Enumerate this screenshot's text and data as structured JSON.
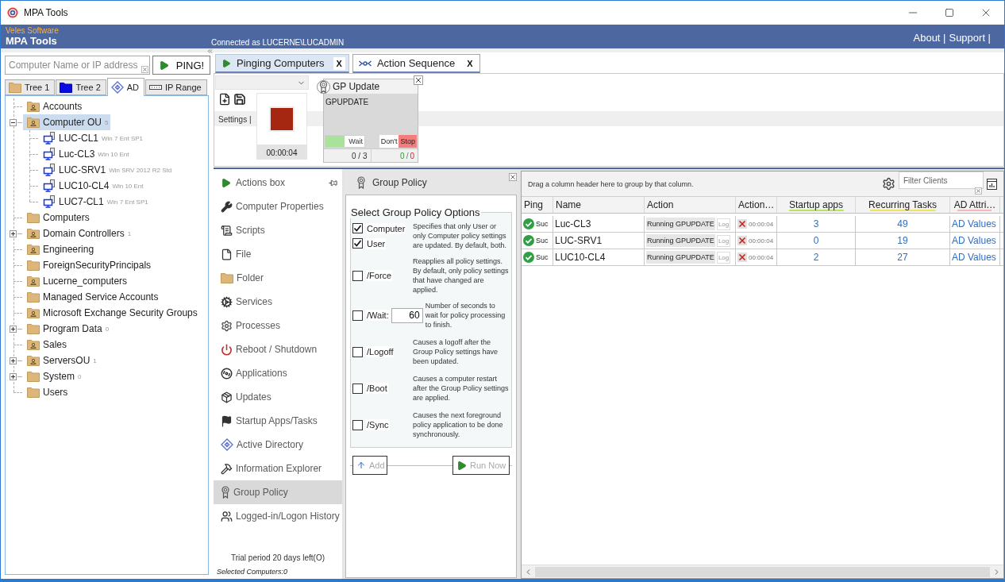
{
  "window": {
    "title": "MPA Tools"
  },
  "header": {
    "vendor": "Veles Software",
    "product": "MPA Tools",
    "connection": "Connected as LUCERNE\\LUCADMIN",
    "links": [
      "About |",
      "Support |"
    ]
  },
  "search": {
    "placeholder": "Computer Name or IP address",
    "button": "PING!"
  },
  "tree_tabs": [
    {
      "label": "Tree 1",
      "kind": "folder",
      "selected": false
    },
    {
      "label": "Tree 2",
      "kind": "blue-folder",
      "selected": false
    },
    {
      "label": "AD",
      "kind": "directory",
      "selected": true
    },
    {
      "label": "IP Range",
      "kind": "range",
      "selected": false
    }
  ],
  "tree": [
    {
      "label": "Accounts",
      "kind": "ou",
      "selected": false
    },
    {
      "label": "Computer OU",
      "kind": "ou",
      "count": "5",
      "selected": true,
      "expanded": true,
      "children": [
        {
          "label": "LUC-CL1",
          "kind": "computer",
          "os": "Win 7 Ent SP1",
          "selected": false
        },
        {
          "label": "Luc-CL3",
          "kind": "computer",
          "os": "Win 10 Ent",
          "selected": false
        },
        {
          "label": "LUC-SRV1",
          "kind": "computer",
          "os": "Win SRV 2012 R2 Std",
          "selected": false
        },
        {
          "label": "LUC10-CL4",
          "kind": "computer",
          "os": "Win 10 Ent",
          "selected": false
        },
        {
          "label": "LUC7-CL1",
          "kind": "computer",
          "os": "Win 7 Ent SP1",
          "selected": false
        }
      ]
    },
    {
      "label": "Computers",
      "kind": "folder",
      "selected": false
    },
    {
      "label": "Domain Controllers",
      "kind": "ou",
      "count": "1",
      "selected": false,
      "expanded": false
    },
    {
      "label": "Engineering",
      "kind": "ou",
      "selected": false
    },
    {
      "label": "ForeignSecurityPrincipals",
      "kind": "folder",
      "selected": false
    },
    {
      "label": "Lucerne_computers",
      "kind": "ou",
      "selected": false
    },
    {
      "label": "Managed Service Accounts",
      "kind": "folder",
      "selected": false
    },
    {
      "label": "Microsoft Exchange Security Groups",
      "kind": "ou",
      "selected": false
    },
    {
      "label": "Program Data",
      "kind": "folder",
      "count": "0",
      "selected": false,
      "expanded": false
    },
    {
      "label": "Sales",
      "kind": "ou",
      "selected": false
    },
    {
      "label": "ServersOU",
      "kind": "ou",
      "count": "1",
      "selected": false,
      "expanded": false
    },
    {
      "label": "System",
      "kind": "folder",
      "count": "0",
      "selected": false,
      "expanded": false
    },
    {
      "label": "Users",
      "kind": "folder",
      "selected": false
    }
  ],
  "session_tabs": [
    {
      "label": "Pinging Computers",
      "kind": "ping",
      "close": "X",
      "selected": true
    },
    {
      "label": "Action Sequence",
      "kind": "sequence",
      "close": "X",
      "selected": false
    }
  ],
  "sequence": {
    "settings_label": "Settings |",
    "timer": "00:00:04",
    "steps": [
      {
        "title": "GP Update",
        "command": "GPUPDATE",
        "wait": {
          "label": "Wait",
          "on": true
        },
        "on_error": [
          {
            "label": "Don't",
            "selected": false
          },
          {
            "label": "Stop",
            "selected": true
          }
        ],
        "progress": "0 / 3",
        "succeeded": "0",
        "separator": "/",
        "failed": "0"
      }
    ]
  },
  "actions": {
    "title": "Actions box",
    "items": [
      {
        "label": "Computer Properties",
        "kind": "properties",
        "selected": false
      },
      {
        "label": "Scripts",
        "kind": "scripts",
        "selected": false
      },
      {
        "label": "File",
        "kind": "file",
        "selected": false
      },
      {
        "label": "Folder",
        "kind": "folder",
        "selected": false
      },
      {
        "label": "Services",
        "kind": "services",
        "selected": false
      },
      {
        "label": "Processes",
        "kind": "processes",
        "selected": false
      },
      {
        "label": "Reboot / Shutdown",
        "kind": "reboot",
        "selected": false
      },
      {
        "label": "Applications",
        "kind": "applications",
        "selected": false
      },
      {
        "label": "Updates",
        "kind": "updates",
        "selected": false
      },
      {
        "label": "Startup Apps/Tasks",
        "kind": "startup",
        "selected": false
      },
      {
        "label": "Active Directory",
        "kind": "directory",
        "selected": false
      },
      {
        "label": "Information Explorer",
        "kind": "explorer",
        "selected": false
      },
      {
        "label": "Group Policy",
        "kind": "policy",
        "selected": true
      },
      {
        "label": "Logged-in/Logon History",
        "kind": "logon",
        "selected": false
      }
    ],
    "trial": "Trial period 20 days left(O)",
    "selection": "Selected Computers:0"
  },
  "group_policy": {
    "title": "Group Policy",
    "legend": "Select Group Policy Options",
    "groups": [
      {
        "options": [
          {
            "label": "Computer",
            "checked": true
          },
          {
            "label": "User",
            "checked": true
          }
        ],
        "description": "Specifies that only User or only Computer policy settings are updated. By default, both."
      },
      {
        "options": [
          {
            "label": "/Force",
            "checked": false
          }
        ],
        "description": "Reapplies all policy settings. By default, only policy settings that have changed are applied."
      },
      {
        "options": [
          {
            "label": "/Wait:",
            "checked": false,
            "value": "60"
          }
        ],
        "description": "Number of seconds to wait for policy processing to finish."
      },
      {
        "options": [
          {
            "label": "/Logoff",
            "checked": false
          }
        ],
        "description": "Causes a logoff after the Group Policy settings have been updated."
      },
      {
        "options": [
          {
            "label": "/Boot",
            "checked": false
          }
        ],
        "description": "Causes a computer restart after the Group Policy settings are applied."
      },
      {
        "options": [
          {
            "label": "/Sync",
            "checked": false
          }
        ],
        "description": "Causes the next foreground policy application to be done synchronously."
      }
    ],
    "buttons": [
      {
        "label": "Add",
        "kind": "add",
        "disabled": true
      },
      {
        "label": "Run Now",
        "kind": "run",
        "disabled": true
      }
    ]
  },
  "grid": {
    "group_hint": "Drag a column header here to group by that column.",
    "filter_placeholder": "Filter Clients",
    "columns": [
      {
        "label": "Ping"
      },
      {
        "label": "Name"
      },
      {
        "label": "Action"
      },
      {
        "label": "Action…"
      },
      {
        "label": "Startup apps",
        "color": "#b5e55a"
      },
      {
        "label": "Recurring Tasks",
        "color": "#eee35a"
      },
      {
        "label": "AD Attri…",
        "color": "#f4b8b8"
      }
    ],
    "rows": [
      {
        "ping_ok": true,
        "ping": "Suc",
        "name": "Luc-CL3",
        "action": "Running GPUPDATE",
        "log": "Log",
        "elapsed": "00:00:04",
        "startup_apps": "3",
        "recurring_tasks": "49",
        "ad_attributes": "AD Values"
      },
      {
        "ping_ok": true,
        "ping": "Suc",
        "name": "LUC-SRV1",
        "action": "Running GPUPDATE",
        "log": "Log",
        "elapsed": "00:00:04",
        "startup_apps": "0",
        "recurring_tasks": "19",
        "ad_attributes": "AD Values"
      },
      {
        "ping_ok": true,
        "ping": "Suc",
        "name": "LUC10-CL4",
        "action": "Running GPUPDATE",
        "log": "Log",
        "elapsed": "00:00:04",
        "startup_apps": "2",
        "recurring_tasks": "27",
        "ad_attributes": "AD Values"
      }
    ]
  }
}
